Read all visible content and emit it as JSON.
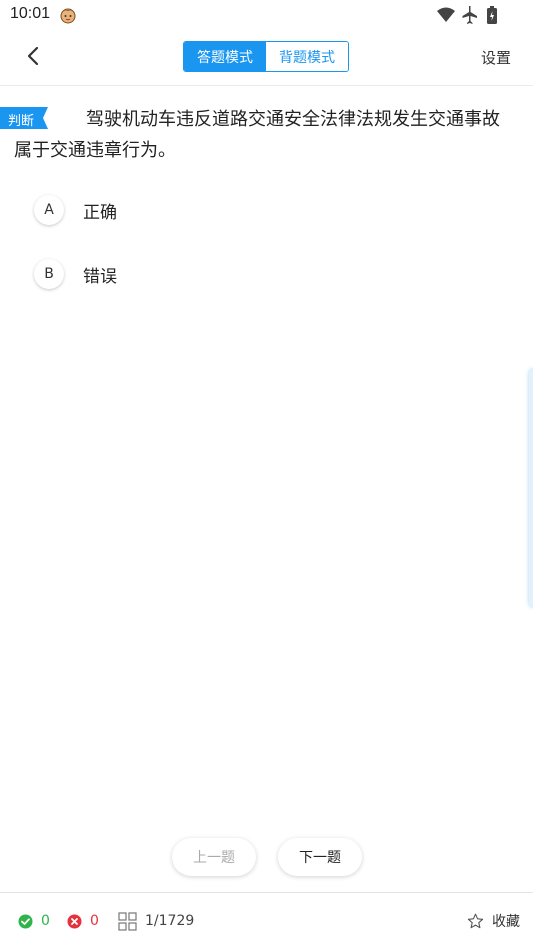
{
  "status_bar": {
    "time": "10:01"
  },
  "nav": {
    "mode_answer": "答题模式",
    "mode_memorize": "背题模式",
    "settings": "设置"
  },
  "question": {
    "type_tag": "判断",
    "text": "驾驶机动车违反道路交通安全法律法规发生交通事故属于交通违章行为。"
  },
  "options": [
    {
      "letter": "A",
      "text": "正确"
    },
    {
      "letter": "B",
      "text": "错误"
    }
  ],
  "buttons": {
    "prev": "上一题",
    "next": "下一题"
  },
  "footer": {
    "correct_count": "0",
    "wrong_count": "0",
    "progress": "1/1729",
    "favorite": "收藏"
  },
  "colors": {
    "accent": "#1a96f0",
    "correct": "#2fb34a",
    "wrong": "#e5323c"
  }
}
